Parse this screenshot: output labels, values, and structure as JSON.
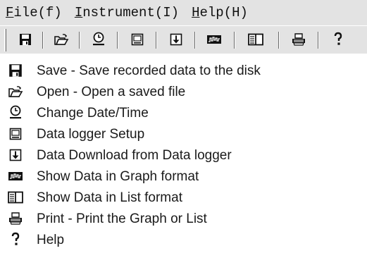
{
  "menubar": {
    "items": [
      {
        "accel": "F",
        "rest": "ile(f)"
      },
      {
        "accel": "I",
        "rest": "nstrument(I)"
      },
      {
        "accel": "H",
        "rest": "elp(H)"
      }
    ]
  },
  "toolbar": {
    "buttons": [
      {
        "icon": "save-icon"
      },
      {
        "icon": "open-folder-icon"
      },
      {
        "icon": "clock-icon"
      },
      {
        "icon": "logger-setup-icon"
      },
      {
        "icon": "download-icon"
      },
      {
        "icon": "graph-icon"
      },
      {
        "icon": "list-icon"
      },
      {
        "icon": "printer-icon"
      },
      {
        "icon": "help-icon"
      }
    ]
  },
  "legend": {
    "items": [
      {
        "icon": "save-icon",
        "text": "Save - Save recorded data to the disk"
      },
      {
        "icon": "open-folder-icon",
        "text": "Open - Open a saved file"
      },
      {
        "icon": "clock-icon",
        "text": "Change Date/Time"
      },
      {
        "icon": "logger-setup-icon",
        "text": "Data logger Setup"
      },
      {
        "icon": "download-icon",
        "text": "Data Download from Data logger"
      },
      {
        "icon": "graph-icon",
        "text": "Show Data in Graph format"
      },
      {
        "icon": "list-icon",
        "text": "Show Data in List format"
      },
      {
        "icon": "printer-icon",
        "text": "Print - Print the Graph or List"
      },
      {
        "icon": "help-icon",
        "text": "Help"
      }
    ]
  }
}
